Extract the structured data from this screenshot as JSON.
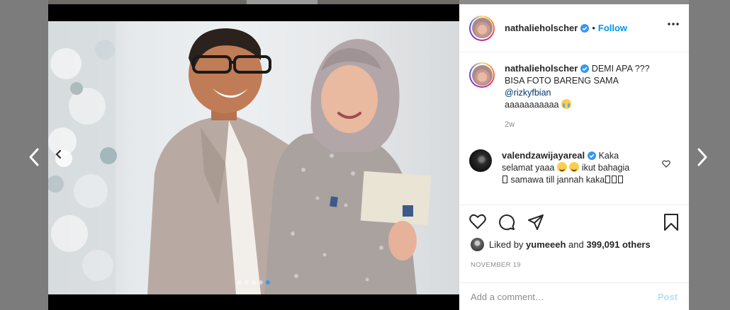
{
  "post": {
    "author": "nathalieholscher",
    "follow_label": "Follow",
    "bullet": "•",
    "photo_alt": "",
    "carousel": {
      "count": 5,
      "active_index": 4
    }
  },
  "caption": {
    "username": "nathalieholscher",
    "text_line1": "DEMI APA ???",
    "text_line2": "BISA FOTO BARENG SAMA",
    "mention": "@rizkyfbian",
    "text_line3": "aaaaaaaaaaa",
    "time": "2w"
  },
  "comments": [
    {
      "username": "valendzawijayareal",
      "text_part1": "Kaka",
      "text_part2": "selamat yaaa",
      "text_part3": "ikut bahagia",
      "text_part4": "samawa till jannah kaka"
    }
  ],
  "likes": {
    "prefix": "Liked by",
    "user": "yumeeeh",
    "and": "and",
    "others": "399,091 others"
  },
  "date": "NOVEMBER 19",
  "add_comment": {
    "placeholder": "Add a comment…",
    "post_label": "Post"
  },
  "colors": {
    "link": "#0095f6",
    "post_disabled": "#b2dffc",
    "active_dot": "#3897f0"
  },
  "icons": [
    "chevron-left-icon",
    "chevron-right-icon",
    "verified-icon",
    "more-icon",
    "heart-icon",
    "comment-icon",
    "share-icon",
    "bookmark-icon"
  ]
}
